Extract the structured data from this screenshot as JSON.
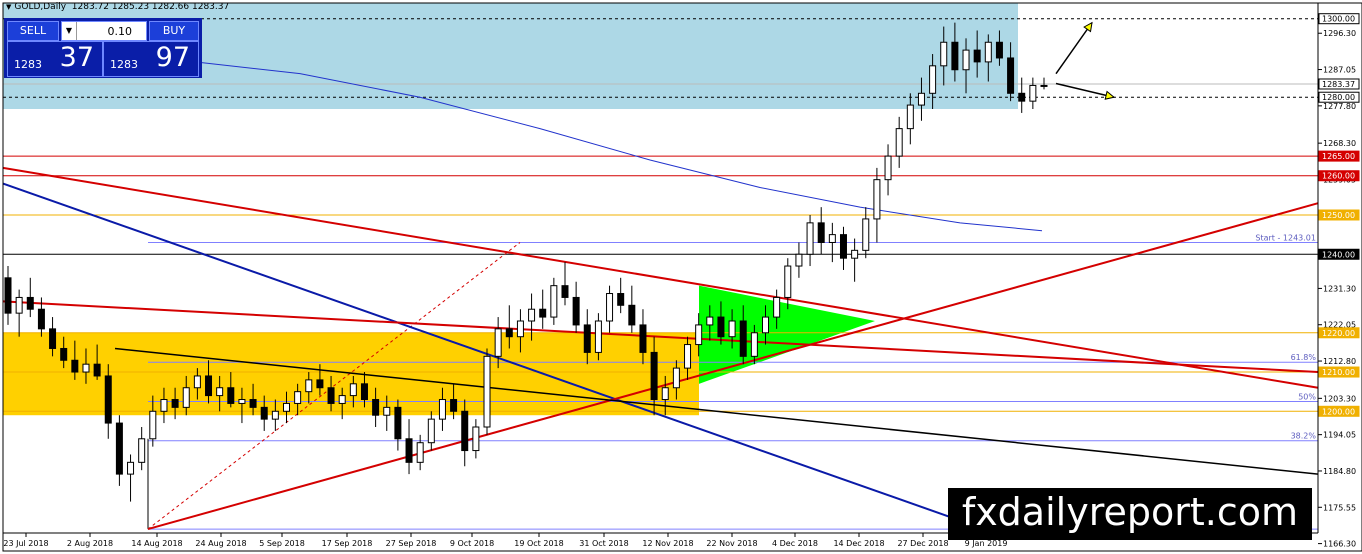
{
  "header": {
    "symbol": "GOLD,Daily",
    "quotes": "1283.72 1285.23 1282.66 1283.37"
  },
  "trade_panel": {
    "sell_label": "SELL",
    "buy_label": "BUY",
    "lot_value": "0.10",
    "sell_price_small": "1283",
    "sell_price_big": "37",
    "buy_price_small": "1283",
    "buy_price_big": "97"
  },
  "watermark": "fxdailyreport.com",
  "colors": {
    "zone_blue": "#add8e6",
    "zone_yellow": "#ffd000",
    "triangle_green": "#00ff00",
    "trend_red": "#d40000",
    "trend_blue": "#0a1aa8",
    "fib_line": "#8080ff",
    "ma_line": "#2233cc"
  },
  "chart_data": {
    "type": "candlestick",
    "symbol": "GOLD",
    "timeframe": "Daily",
    "ylim": [
      1169,
      1304
    ],
    "y_ticks": [
      "1296.30",
      "1287.05",
      "1277.80",
      "1268.30",
      "1259.05",
      "1249.80",
      "1240.55",
      "1231.30",
      "1222.05",
      "1212.80",
      "1203.30",
      "1194.05",
      "1184.80",
      "1175.55",
      "1166.30"
    ],
    "x_tick_labels": [
      "23 Jul 2018",
      "2 Aug 2018",
      "14 Aug 2018",
      "24 Aug 2018",
      "5 Sep 2018",
      "17 Sep 2018",
      "27 Sep 2018",
      "9 Oct 2018",
      "19 Oct 2018",
      "31 Oct 2018",
      "12 Nov 2018",
      "22 Nov 2018",
      "4 Dec 2018",
      "14 Dec 2018",
      "27 Dec 2018",
      "9 Jan 2019"
    ],
    "level_labels": [
      {
        "price": 1300.0,
        "text": "1300.00"
      },
      {
        "price": 1283.37,
        "text": "1283.37"
      },
      {
        "price": 1280.0,
        "text": "1280.00"
      },
      {
        "price": 1265.0,
        "text": "1265.00"
      },
      {
        "price": 1260.0,
        "text": "1260.00"
      },
      {
        "price": 1250.0,
        "text": "1250.00"
      },
      {
        "price": 1240.0,
        "text": "1240.00"
      },
      {
        "price": 1220.0,
        "text": "1220.00"
      },
      {
        "price": 1210.0,
        "text": "1210.00"
      },
      {
        "price": 1200.0,
        "text": "1200.00"
      }
    ],
    "annotations": [
      {
        "price": 1243.01,
        "text": "Start - 1243.01"
      },
      {
        "price": 1212.5,
        "text": "61.8%"
      },
      {
        "price": 1202.5,
        "text": "50%"
      },
      {
        "price": 1192.5,
        "text": "38.2%"
      }
    ],
    "candles": [
      [
        1234,
        1237,
        1222,
        1225
      ],
      [
        1225,
        1231,
        1219,
        1229
      ],
      [
        1229,
        1234,
        1224,
        1226
      ],
      [
        1226,
        1229,
        1219,
        1221
      ],
      [
        1221,
        1224,
        1214,
        1216
      ],
      [
        1216,
        1219,
        1211,
        1213
      ],
      [
        1213,
        1218,
        1208,
        1210
      ],
      [
        1210,
        1216,
        1207,
        1212
      ],
      [
        1212,
        1217,
        1208,
        1209
      ],
      [
        1209,
        1212,
        1193,
        1197
      ],
      [
        1197,
        1199,
        1181,
        1184
      ],
      [
        1184,
        1189,
        1177,
        1187
      ],
      [
        1187,
        1196,
        1185,
        1193
      ],
      [
        1193,
        1204,
        1191,
        1200
      ],
      [
        1200,
        1206,
        1197,
        1203
      ],
      [
        1203,
        1206,
        1198,
        1201
      ],
      [
        1201,
        1209,
        1199,
        1206
      ],
      [
        1206,
        1211,
        1203,
        1209
      ],
      [
        1209,
        1213,
        1202,
        1204
      ],
      [
        1204,
        1209,
        1200,
        1206
      ],
      [
        1206,
        1210,
        1201,
        1202
      ],
      [
        1202,
        1206,
        1197,
        1203
      ],
      [
        1203,
        1207,
        1199,
        1201
      ],
      [
        1201,
        1204,
        1195,
        1198
      ],
      [
        1198,
        1203,
        1195,
        1200
      ],
      [
        1200,
        1205,
        1197,
        1202
      ],
      [
        1202,
        1207,
        1199,
        1205
      ],
      [
        1205,
        1210,
        1202,
        1208
      ],
      [
        1208,
        1212,
        1204,
        1206
      ],
      [
        1206,
        1209,
        1200,
        1202
      ],
      [
        1202,
        1206,
        1198,
        1204
      ],
      [
        1204,
        1209,
        1201,
        1207
      ],
      [
        1207,
        1210,
        1201,
        1203
      ],
      [
        1203,
        1206,
        1196,
        1199
      ],
      [
        1199,
        1204,
        1195,
        1201
      ],
      [
        1201,
        1203,
        1190,
        1193
      ],
      [
        1193,
        1198,
        1184,
        1187
      ],
      [
        1187,
        1194,
        1185,
        1192
      ],
      [
        1192,
        1200,
        1190,
        1198
      ],
      [
        1198,
        1206,
        1195,
        1203
      ],
      [
        1203,
        1207,
        1198,
        1200
      ],
      [
        1200,
        1203,
        1186,
        1190
      ],
      [
        1190,
        1198,
        1188,
        1196
      ],
      [
        1196,
        1216,
        1194,
        1214
      ],
      [
        1214,
        1224,
        1211,
        1221
      ],
      [
        1221,
        1227,
        1216,
        1219
      ],
      [
        1219,
        1226,
        1215,
        1223
      ],
      [
        1223,
        1230,
        1218,
        1226
      ],
      [
        1226,
        1231,
        1221,
        1224
      ],
      [
        1224,
        1234,
        1222,
        1232
      ],
      [
        1232,
        1238,
        1227,
        1229
      ],
      [
        1229,
        1233,
        1220,
        1222
      ],
      [
        1222,
        1226,
        1212,
        1215
      ],
      [
        1215,
        1225,
        1213,
        1223
      ],
      [
        1223,
        1232,
        1220,
        1230
      ],
      [
        1230,
        1234,
        1225,
        1227
      ],
      [
        1227,
        1232,
        1220,
        1222
      ],
      [
        1222,
        1226,
        1212,
        1215
      ],
      [
        1215,
        1219,
        1199,
        1203
      ],
      [
        1203,
        1209,
        1199,
        1206
      ],
      [
        1206,
        1213,
        1203,
        1211
      ],
      [
        1211,
        1219,
        1208,
        1217
      ],
      [
        1217,
        1225,
        1214,
        1222
      ],
      [
        1222,
        1227,
        1218,
        1224
      ],
      [
        1224,
        1228,
        1217,
        1219
      ],
      [
        1219,
        1226,
        1216,
        1223
      ],
      [
        1223,
        1227,
        1212,
        1214
      ],
      [
        1214,
        1222,
        1212,
        1220
      ],
      [
        1220,
        1227,
        1217,
        1224
      ],
      [
        1224,
        1231,
        1221,
        1229
      ],
      [
        1229,
        1239,
        1226,
        1237
      ],
      [
        1237,
        1243,
        1234,
        1240
      ],
      [
        1240,
        1250,
        1237,
        1248
      ],
      [
        1248,
        1252,
        1240,
        1243
      ],
      [
        1243,
        1248,
        1238,
        1245
      ],
      [
        1245,
        1247,
        1236,
        1239
      ],
      [
        1239,
        1244,
        1233,
        1241
      ],
      [
        1241,
        1252,
        1239,
        1249
      ],
      [
        1249,
        1262,
        1243,
        1259
      ],
      [
        1259,
        1268,
        1255,
        1265
      ],
      [
        1265,
        1275,
        1262,
        1272
      ],
      [
        1272,
        1281,
        1268,
        1278
      ],
      [
        1278,
        1285,
        1274,
        1281
      ],
      [
        1281,
        1291,
        1277,
        1288
      ],
      [
        1288,
        1298,
        1283,
        1294
      ],
      [
        1294,
        1299,
        1284,
        1287
      ],
      [
        1287,
        1295,
        1281,
        1292
      ],
      [
        1292,
        1297,
        1285,
        1289
      ],
      [
        1289,
        1296,
        1284,
        1294
      ],
      [
        1294,
        1297,
        1288,
        1290
      ],
      [
        1290,
        1294,
        1279,
        1281
      ],
      [
        1281,
        1285,
        1276,
        1279
      ],
      [
        1279,
        1285,
        1277,
        1283
      ],
      [
        1283,
        1285,
        1282,
        1283
      ]
    ]
  }
}
